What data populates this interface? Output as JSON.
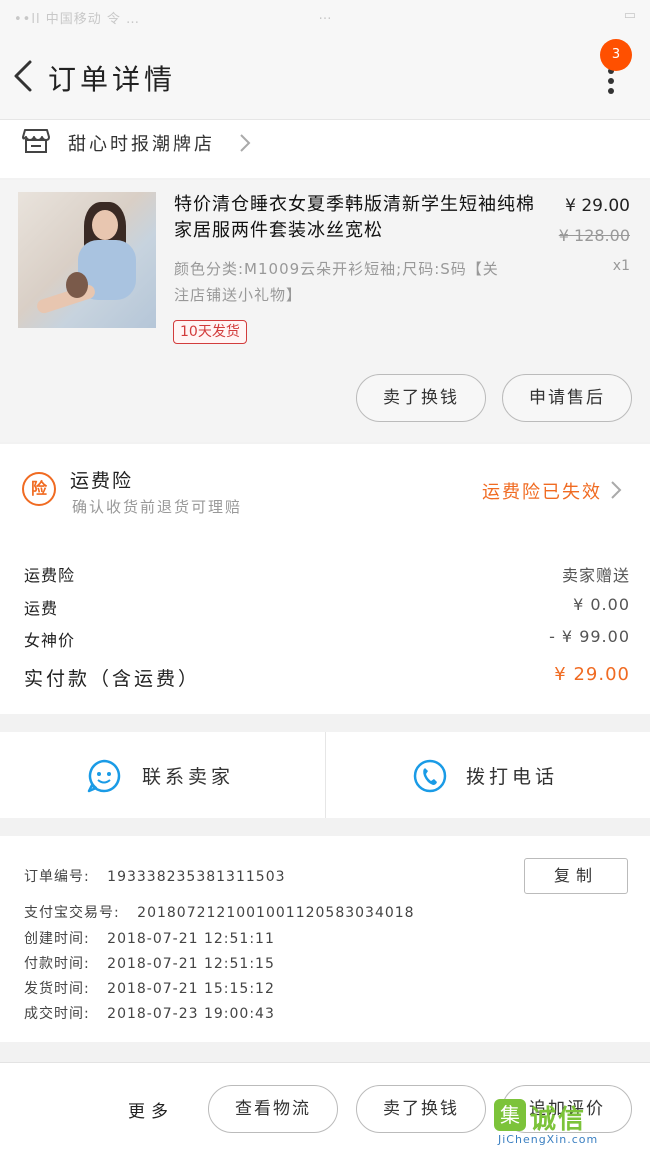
{
  "statusbar": {
    "left": "••ll 中国移动 令 …",
    "center": "…",
    "right": "▭"
  },
  "nav": {
    "title": "订单详情",
    "badge": "3"
  },
  "shop": {
    "name": "甜心时报潮牌店"
  },
  "item": {
    "title": "特价清仓睡衣女夏季韩版清新学生短袖纯棉家居服两件套装冰丝宽松",
    "sku": "颜色分类:M1009云朵开衫短袖;尺码:S码【关注店铺送小礼物】",
    "tag": "10天发货",
    "price": "¥ 29.00",
    "original_price": "¥ 128.00",
    "quantity": "x1",
    "btn_resell": "卖了换钱",
    "btn_after_sale": "申请售后"
  },
  "insurance": {
    "icon_text": "险",
    "title": "运费险",
    "desc": "确认收货前退货可理赔",
    "status": "运费险已失效"
  },
  "fees": [
    {
      "k": "运费险",
      "v": "卖家赠送"
    },
    {
      "k": "运费",
      "v": "¥ 0.00"
    },
    {
      "k": "女神价",
      "v": "- ¥ 99.00"
    },
    {
      "k": "实付款（含运费）",
      "v": "¥ 29.00"
    }
  ],
  "contact": {
    "chat": "联系卖家",
    "call": "拨打电话"
  },
  "order_info": {
    "order_no_label": "订单编号:",
    "order_no": "193338235381311503",
    "alipay_label": "支付宝交易号:",
    "alipay_no": "2018072121001001120583034018",
    "created_label": "创建时间:",
    "created": "2018-07-21 12:51:11",
    "paid_label": "付款时间:",
    "paid": "2018-07-21 12:51:15",
    "shipped_label": "发货时间:",
    "shipped": "2018-07-21 15:15:12",
    "done_label": "成交时间:",
    "done": "2018-07-23 19:00:43",
    "copy": "复制"
  },
  "bottom": {
    "more": "更多",
    "logistics": "查看物流",
    "resell": "卖了换钱",
    "review": "追加评价"
  },
  "watermark": {
    "logo": "集",
    "text": "诚信",
    "url": "JiChengXin.com"
  },
  "colors": {
    "accent": "#ff5000",
    "orange": "#f06b22",
    "blue": "#1a9be6"
  }
}
